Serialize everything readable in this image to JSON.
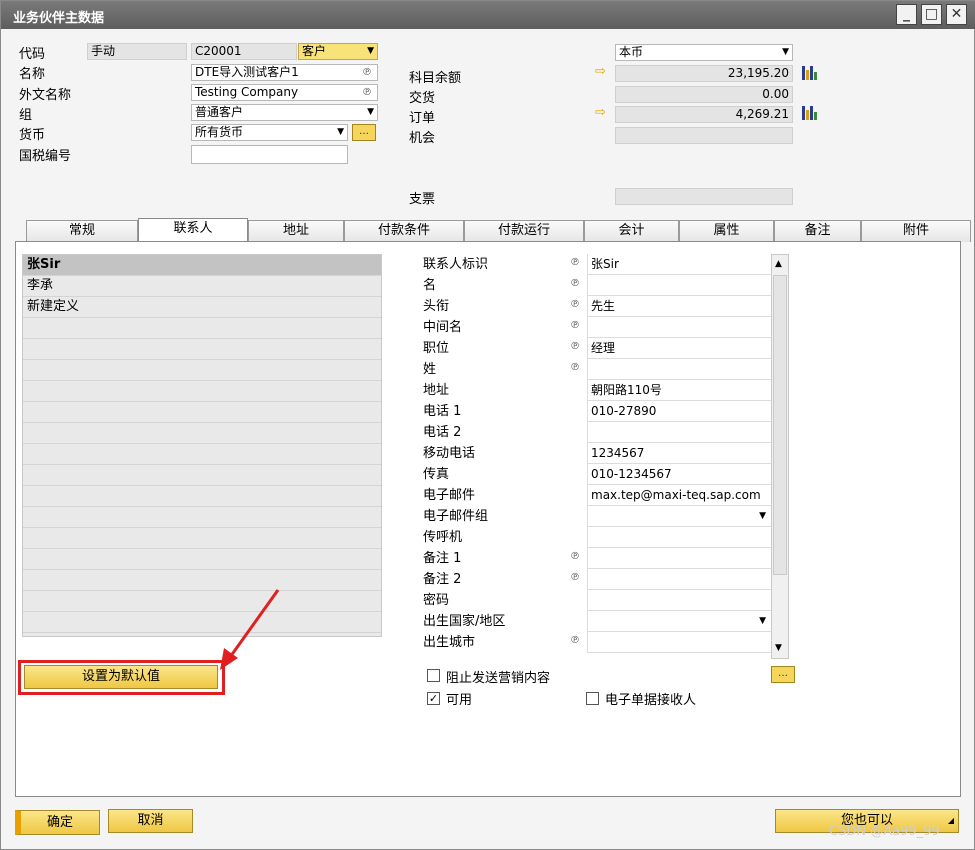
{
  "window": {
    "title": "业务伙伴主数据"
  },
  "header": {
    "code_label": "代码",
    "code_mode": "手动",
    "code_value": "C20001",
    "type_value": "客户",
    "name_label": "名称",
    "name_value": "DTE导入测试客户1",
    "foreign_name_label": "外文名称",
    "foreign_name_value": "Testing Company",
    "group_label": "组",
    "group_value": "普通客户",
    "currency_label": "货币",
    "currency_value": "所有货币",
    "tax_label": "国税编号",
    "tax_value": "",
    "balance_currency": "本币",
    "balance_label": "科目余额",
    "balance_value": "23,195.20",
    "delivery_label": "交货",
    "delivery_value": "0.00",
    "orders_label": "订单",
    "orders_value": "4,269.21",
    "opportunity_label": "机会",
    "opportunity_value": "",
    "cheque_label": "支票",
    "cheque_value": ""
  },
  "tabs": [
    "常规",
    "联系人",
    "地址",
    "付款条件",
    "付款运行",
    "会计",
    "属性",
    "备注",
    "附件"
  ],
  "contacts": {
    "list": [
      "张Sir",
      "李承",
      "新建定义"
    ],
    "set_default_button": "设置为默认值",
    "fields": [
      {
        "label": "联系人标识",
        "value": "张Sir"
      },
      {
        "label": "名",
        "value": ""
      },
      {
        "label": "头衔",
        "value": "先生"
      },
      {
        "label": "中间名",
        "value": ""
      },
      {
        "label": "职位",
        "value": "经理"
      },
      {
        "label": "姓",
        "value": ""
      },
      {
        "label": "地址",
        "value": "朝阳路110号"
      },
      {
        "label": "电话 1",
        "value": "010-27890"
      },
      {
        "label": "电话 2",
        "value": ""
      },
      {
        "label": "移动电话",
        "value": "1234567"
      },
      {
        "label": "传真",
        "value": "010-1234567"
      },
      {
        "label": "电子邮件",
        "value": "max.tep@maxi-teq.sap.com"
      },
      {
        "label": "电子邮件组",
        "value": ""
      },
      {
        "label": "传呼机",
        "value": ""
      },
      {
        "label": "备注 1",
        "value": ""
      },
      {
        "label": "备注 2",
        "value": ""
      },
      {
        "label": "密码",
        "value": ""
      },
      {
        "label": "出生国家/地区",
        "value": ""
      },
      {
        "label": "出生城市",
        "value": ""
      }
    ],
    "block_marketing_label": "阻止发送营销内容",
    "active_label": "可用",
    "e_doc_label": "电子单据接收人"
  },
  "footer": {
    "ok": "确定",
    "cancel": "取消",
    "also": "您也可以"
  },
  "watermark": "CSDN @Aa99_99",
  "colors": {
    "accent_yellow": "#f6d65a",
    "highlight_red": "#e02020",
    "title_gray": "#6a6a6a"
  }
}
